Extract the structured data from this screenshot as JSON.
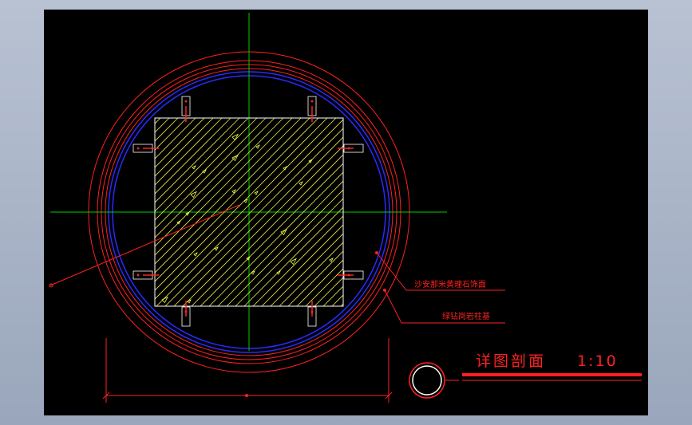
{
  "drawing": {
    "title": "详图剖面",
    "scale": "1:10",
    "annotations": [
      {
        "id": "finish",
        "text": "沙安那米黄理石饰面"
      },
      {
        "id": "base",
        "text": "绿钻岗岩柱基"
      }
    ],
    "colors": {
      "background": "#000000",
      "outer_ring": "#ff2020",
      "inner_ring": "#2020ff",
      "centerline": "#00cc00",
      "hatch": "#ffff40",
      "annotation": "#ff2020"
    }
  }
}
